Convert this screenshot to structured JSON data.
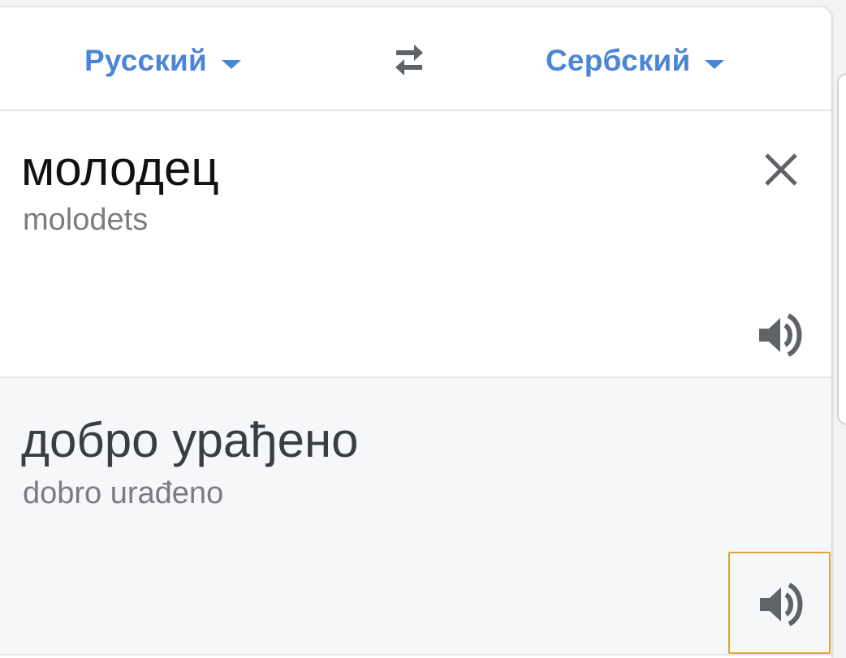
{
  "header": {
    "source_language": "Русский",
    "target_language": "Сербский"
  },
  "source": {
    "text": "молодец",
    "transliteration": "molodets"
  },
  "translation": {
    "text": "добро урађено",
    "transliteration": "dobro urađeno"
  },
  "icons": {
    "swap": "swap-arrows-icon",
    "close": "close-icon",
    "speaker": "speaker-icon",
    "caret": "caret-down-icon"
  },
  "colors": {
    "accent": "#4b86d6",
    "focus_outline": "#e0a531",
    "icon": "#5f6368"
  }
}
